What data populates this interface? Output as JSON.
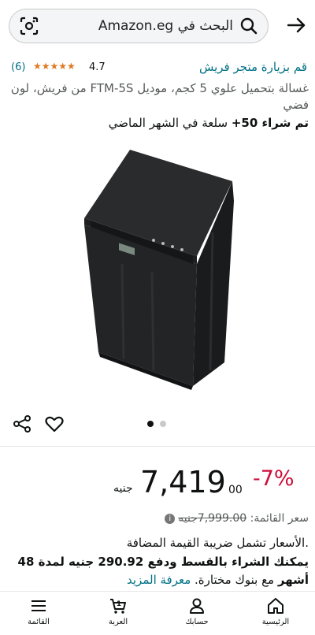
{
  "search": {
    "value": "البحث في Amazon.eg"
  },
  "product": {
    "store_link": "قم بزيارة متجر فريش",
    "rating_value": "4.7",
    "stars": "★★★★★",
    "rating_count": "(6)",
    "title": "غسالة بتحميل علوي 5 كجم، موديل FTM-5S من فريش، لون فضي",
    "bought_bold": "تم شراء 50+",
    "bought_rest": " سلعة في الشهر الماضي",
    "carousel_count": 2,
    "carousel_active": 1
  },
  "price": {
    "discount": "-7%",
    "currency": "جنيه",
    "whole": "7,419",
    "fraction": "00",
    "list_label": "سعر القائمة: ",
    "list_value": "7,999.00جنيه",
    "info_icon_glyph": "i",
    "vat_note": ".الأسعار تشمل ضريبة القيمة المضافة",
    "installment_bold": "يمكنك الشراء بالقسط ودفع 290.92 جنيه لمدة 48 أشهر",
    "installment_plain": " مع بنوك مختارة. ",
    "learn_more": "معرفة المزيد"
  },
  "nav": {
    "home": "الرئيسية",
    "account": "حسابك",
    "cart": "العربة",
    "cart_count": "1",
    "menu": "القائمة"
  },
  "colors": {
    "link": "#007185",
    "discount": "#cc0c39",
    "stars": "#de7921"
  },
  "icons": [
    "back-arrow-icon",
    "search-icon",
    "camera-lens-icon",
    "share-icon",
    "heart-icon",
    "home-icon",
    "account-icon",
    "cart-icon",
    "menu-icon"
  ]
}
